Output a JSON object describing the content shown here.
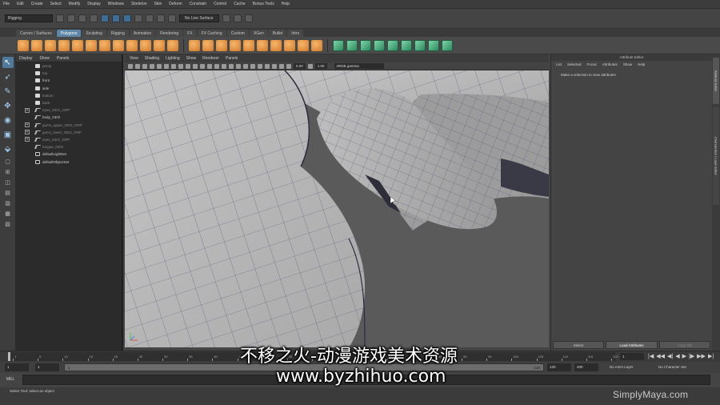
{
  "menubar": [
    "File",
    "Edit",
    "Create",
    "Select",
    "Modify",
    "Display",
    "Windows",
    "Skeleton",
    "Skin",
    "Deform",
    "Constrain",
    "Control",
    "Cache",
    "Bonus Tools",
    "Help"
  ],
  "statusline": {
    "mode": "Rigging",
    "live_surface": "No Live Surface"
  },
  "shelf_tabs": [
    {
      "label": "Curves / Surfaces",
      "active": false
    },
    {
      "label": "Polygons",
      "active": true
    },
    {
      "label": "Sculpting",
      "active": false
    },
    {
      "label": "Rigging",
      "active": false
    },
    {
      "label": "Animation",
      "active": false
    },
    {
      "label": "Rendering",
      "active": false
    },
    {
      "label": "FX",
      "active": false
    },
    {
      "label": "FX Caching",
      "active": false
    },
    {
      "label": "Custom",
      "active": false
    },
    {
      "label": "XGen",
      "active": false
    },
    {
      "label": "Bullet",
      "active": false
    },
    {
      "label": "Intro",
      "active": false
    }
  ],
  "outliner": {
    "menu": [
      "Display",
      "Show",
      "Panels"
    ],
    "items": [
      {
        "label": "persp",
        "kind": "cam",
        "expand": false,
        "dim": true
      },
      {
        "label": "top",
        "kind": "cam",
        "expand": false,
        "dim": true
      },
      {
        "label": "front",
        "kind": "cam",
        "expand": false,
        "dim": false
      },
      {
        "label": "side",
        "kind": "cam",
        "expand": false,
        "dim": false
      },
      {
        "label": "bottom",
        "kind": "cam",
        "expand": false,
        "dim": true
      },
      {
        "label": "back",
        "kind": "cam",
        "expand": false,
        "dim": true
      },
      {
        "label": "eyes_GEO_GRP",
        "kind": "grp",
        "expand": true,
        "dim": true
      },
      {
        "label": "body_GEO",
        "kind": "grp",
        "expand": false,
        "dim": false
      },
      {
        "label": "gums_upper_GEO_GRP",
        "kind": "grp",
        "expand": true,
        "dim": true
      },
      {
        "label": "gums_lower_GEO_GRP",
        "kind": "grp",
        "expand": true,
        "dim": true
      },
      {
        "label": "eyes_GEO_GRP",
        "kind": "grp",
        "expand": true,
        "dim": true
      },
      {
        "label": "tongue_GEO",
        "kind": "grp",
        "expand": false,
        "dim": true
      },
      {
        "label": "defaultLightSet",
        "kind": "set",
        "expand": false,
        "dim": false
      },
      {
        "label": "defaultObjectSet",
        "kind": "set",
        "expand": false,
        "dim": false
      }
    ]
  },
  "viewport": {
    "menu": [
      "View",
      "Shading",
      "Lighting",
      "Show",
      "Renderer",
      "Panels"
    ],
    "field_a": "0.00",
    "field_b": "1.00",
    "color_space": "sRGB gamma"
  },
  "attribute_editor": {
    "title": "Attribute Editor",
    "menu": [
      "List",
      "Selected",
      "Focus",
      "Attributes",
      "Show",
      "Help"
    ],
    "message": "Make a selection to view attributes",
    "buttons": [
      "Select",
      "Load Attributes",
      "Copy Tab"
    ],
    "side_tabs": [
      "Attribute Editor",
      "Channel Box / Layer Editor"
    ]
  },
  "timeline": {
    "ticks": [
      "1",
      "5",
      "10",
      "15",
      "20",
      "25",
      "30",
      "35",
      "40",
      "45",
      "50",
      "55",
      "60",
      "65",
      "70",
      "75",
      "80",
      "85",
      "90",
      "95",
      "100",
      "105",
      "110",
      "115",
      "120"
    ],
    "current_frame": "1",
    "playback": [
      "|◀",
      "◀◀",
      "◀|",
      "◀",
      "▶",
      "|▶",
      "▶▶",
      "▶|"
    ]
  },
  "range": {
    "start": "1",
    "playback_start": "1",
    "slider_start": "1",
    "slider_end": "120",
    "playback_end": "120",
    "end": "200",
    "anim_layer": "No Anim Layer",
    "char_set": "No Character Set"
  },
  "command_line": {
    "label": "MEL"
  },
  "help_line": {
    "text": "Select Tool: select an object"
  },
  "watermark": "SimplyMaya.com",
  "overlay": {
    "line1": "不移之火-动漫游戏美术资源",
    "line2": "www.byzhihuo.com"
  }
}
